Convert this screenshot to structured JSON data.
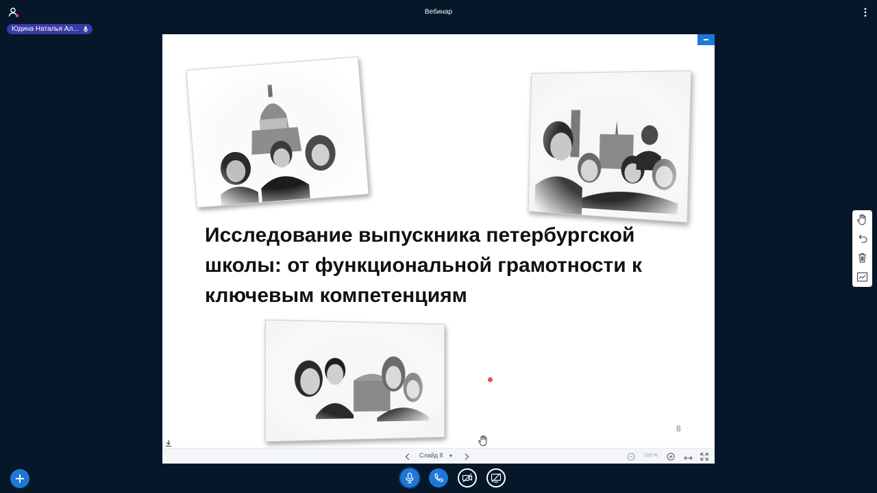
{
  "app": {
    "title": "Вебинар"
  },
  "presenter": {
    "name": "Юдина Наталья Ал..."
  },
  "slide": {
    "title": "Исследование выпускника петербургской школы: от функциональной грамотности к ключевым компетенциям",
    "page_number": "8"
  },
  "toolbar": {
    "slide_label": "Слайд 8",
    "zoom_level": "100 %"
  },
  "icons": {
    "user": "user-icon",
    "menu": "more-vertical-icon",
    "mic": "microphone-icon",
    "download": "download-icon",
    "prev": "chevron-left-icon",
    "next": "chevron-right-icon",
    "zoom_out": "zoom-out-icon",
    "zoom_in": "zoom-in-icon",
    "fit": "fit-width-icon",
    "fullscreen": "fullscreen-icon",
    "hand": "hand-icon",
    "undo": "undo-icon",
    "trash": "trash-icon",
    "multi_user": "multi-user-whiteboard-icon",
    "plus": "plus-icon",
    "phone": "phone-icon",
    "camera_off": "camera-off-icon",
    "screen_share_off": "screen-share-off-icon"
  },
  "colors": {
    "background": "#06172a",
    "accent": "#1e78d6",
    "presenter_chip": "#3a3aa6",
    "laser": "#ef4d4d"
  }
}
